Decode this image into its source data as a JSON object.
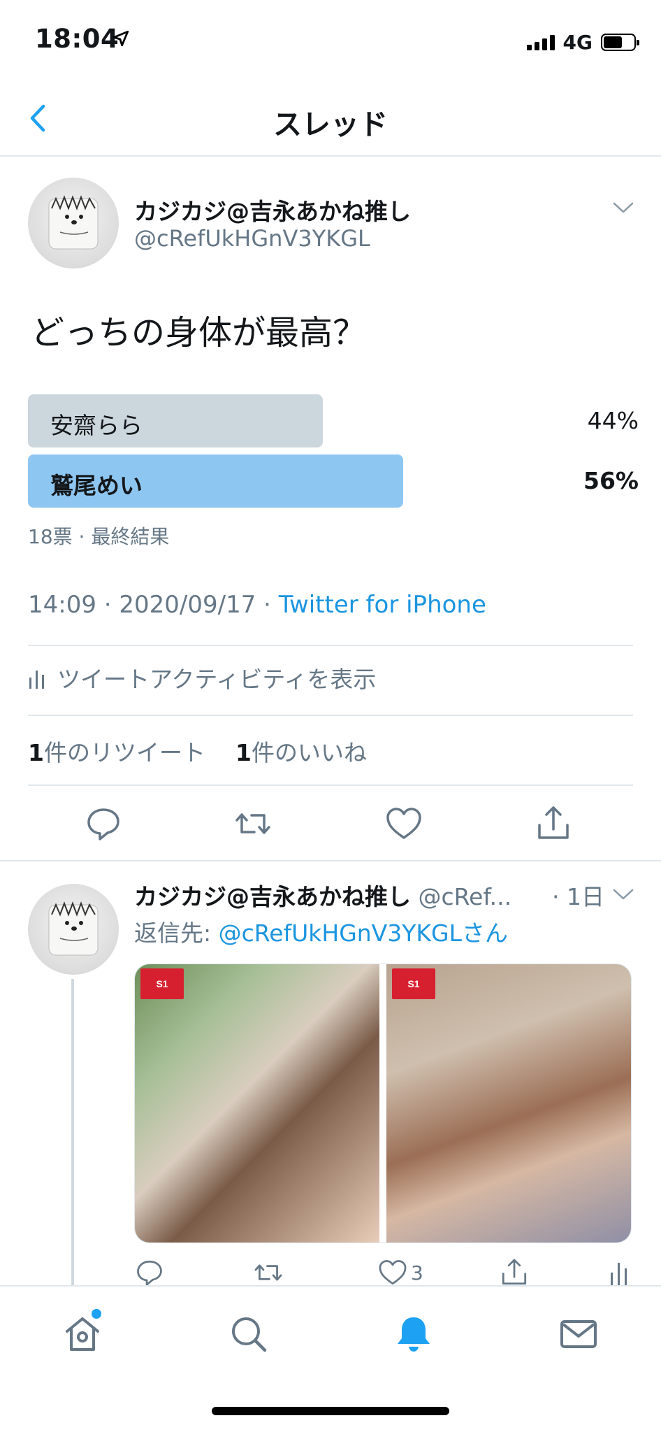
{
  "status_bar": {
    "time": "18:04",
    "network": "4G",
    "battery_level": 0.62
  },
  "nav": {
    "title": "スレッド",
    "back_icon": "chevron-left-icon"
  },
  "tweet": {
    "author_name": "カジカジ@吉永あかね推し",
    "author_handle": "@cRefUkHGnV3YKGL",
    "text": "どっちの身体が最高？",
    "poll": {
      "options": [
        {
          "label": "安齋らら",
          "percent_text": "44%",
          "share": 0.44,
          "winner": false
        },
        {
          "label": "鷲尾めい",
          "percent_text": "56%",
          "share": 0.56,
          "winner": true
        }
      ],
      "meta": "18票 · 最終結果"
    },
    "timestamp": "14:09 · 2020/09/17 · ",
    "source": "Twitter for iPhone",
    "activity_label": "ツイートアクティビティを表示",
    "retweets_count": "1",
    "retweets_label": "件のリツイート",
    "likes_count": "1",
    "likes_label": "件のいいね"
  },
  "reply": {
    "author_name": "カジカジ@吉永あかね推し",
    "author_handle": "@cRef...",
    "time": "· 1日",
    "reply_to_prefix": "返信先: ",
    "reply_to_handle": "@cRefUkHGnV3YKGLさん",
    "image_badge": "S1",
    "like_count": "3"
  },
  "colors": {
    "accent": "#1da1f2",
    "link": "#1b95e0",
    "poll_loser": "#ccd6dd",
    "poll_winner": "#8ec6f2",
    "secondary_text": "#657786",
    "divider": "#e1e8ed"
  },
  "tabbar": {
    "items": [
      "home-icon",
      "search-icon",
      "notifications-icon",
      "messages-icon"
    ],
    "active": "notifications-icon"
  }
}
